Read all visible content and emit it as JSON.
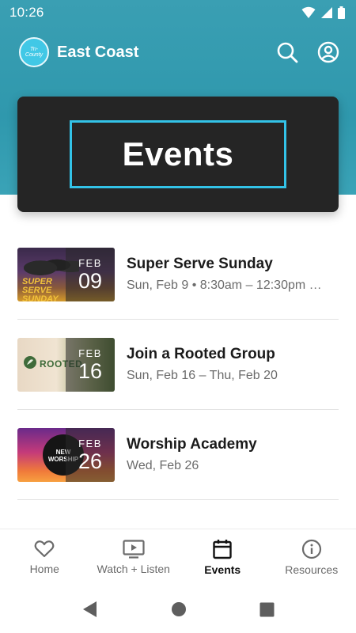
{
  "status_bar": {
    "time": "10:26"
  },
  "app_bar": {
    "title": "East Coast",
    "logo_text": "Tri-County East Coast"
  },
  "hero": {
    "title": "Events",
    "frame_color": "#33c3e8"
  },
  "events": [
    {
      "title": "Super Serve Sunday",
      "subtitle": "Sun, Feb 9 • 8:30am – 12:30pm …",
      "month": "FEB",
      "day": "09",
      "art_text": "SUPER SERVE SUNDAY"
    },
    {
      "title": "Join a Rooted Group",
      "subtitle": "Sun, Feb 16 – Thu, Feb 20",
      "month": "FEB",
      "day": "16",
      "art_text": "ROOTED"
    },
    {
      "title": "Worship Academy",
      "subtitle": "Wed, Feb 26",
      "month": "FEB",
      "day": "26",
      "art_text": "NEW WORSHIP"
    }
  ],
  "bottom_nav": [
    {
      "label": "Home",
      "icon": "heart-icon"
    },
    {
      "label": "Watch + Listen",
      "icon": "play-screen-icon"
    },
    {
      "label": "Events",
      "icon": "calendar-icon",
      "active": true
    },
    {
      "label": "Resources",
      "icon": "info-icon"
    }
  ],
  "colors": {
    "header": "#3a9fb3",
    "accent": "#33c3e8",
    "card": "#252525"
  }
}
